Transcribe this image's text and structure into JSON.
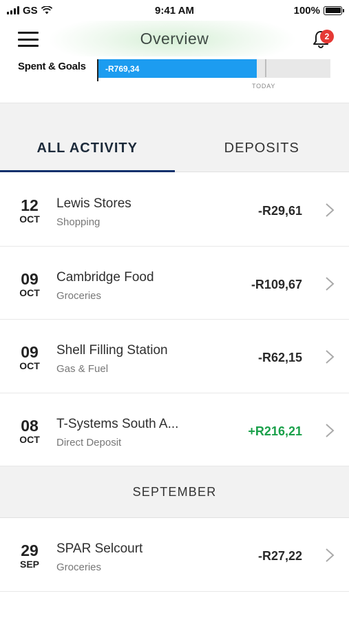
{
  "status_bar": {
    "carrier": "GS",
    "time": "9:41 AM",
    "battery": "100%"
  },
  "header": {
    "title": "Overview",
    "notification_count": "2"
  },
  "spent_goals": {
    "label": "Spent & Goals",
    "amount": "-R769,34",
    "today_label": "TODAY",
    "spent_fraction": 0.68
  },
  "tabs": [
    {
      "label": "ALL ACTIVITY",
      "active": true
    },
    {
      "label": "DEPOSITS",
      "active": false
    }
  ],
  "transactions": [
    {
      "day": "12",
      "month": "OCT",
      "merchant": "Lewis Stores",
      "category": "Shopping",
      "amount": "-R29,61",
      "positive": false
    },
    {
      "day": "09",
      "month": "OCT",
      "merchant": "Cambridge Food",
      "category": "Groceries",
      "amount": "-R109,67",
      "positive": false
    },
    {
      "day": "09",
      "month": "OCT",
      "merchant": "Shell Filling Station",
      "category": "Gas & Fuel",
      "amount": "-R62,15",
      "positive": false
    },
    {
      "day": "08",
      "month": "OCT",
      "merchant": "T-Systems South A...",
      "category": "Direct Deposit",
      "amount": "+R216,21",
      "positive": true
    }
  ],
  "section_september": {
    "label": "SEPTEMBER"
  },
  "transactions_september": [
    {
      "day": "29",
      "month": "SEP",
      "merchant": "SPAR Selcourt",
      "category": "Groceries",
      "amount": "-R27,22",
      "positive": false
    }
  ],
  "colors": {
    "accent_blue": "#1c9cf0",
    "tab_underline": "#0b2f6b",
    "positive_green": "#1aa04a",
    "badge_red": "#e53935"
  },
  "icons": {
    "menu": "hamburger-icon",
    "notifications": "bell-icon",
    "row_action": "chevron-right-icon"
  }
}
